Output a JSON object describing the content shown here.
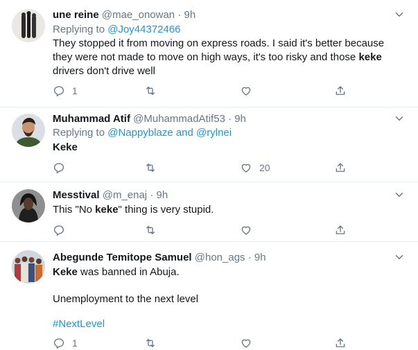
{
  "tweets": [
    {
      "name": "une reine",
      "handle": "@mae_onowan",
      "time": "9h",
      "replying_prefix": "Replying to",
      "replying_to": "@Joy44372466",
      "text_parts": [
        "They stopped it from moving on express roads. I said it's better because they were not made to move on high ways, it's too risky and those ",
        "keke",
        " drivers don't drive well"
      ],
      "reply_count": "1",
      "like_count": ""
    },
    {
      "name": "Muhammad Atif",
      "handle": "@MuhammadAtif53",
      "time": "9h",
      "replying_prefix": "Replying to",
      "replying_to": "@Nappyblaze and @rylnei",
      "text_bold": "Keke",
      "reply_count": "",
      "like_count": "20"
    },
    {
      "name": "Messtival",
      "handle": "@m_enaj",
      "time": "9h",
      "text_parts": [
        "This \"No ",
        "keke",
        "\" thing is very stupid."
      ],
      "reply_count": "",
      "like_count": ""
    },
    {
      "name": "Abegunde Temitope Samuel",
      "handle": "@hon_ags",
      "time": "9h",
      "line1_bold": "Keke",
      "line1_rest": " was banned in Abuja.",
      "line2": "Unemployment to the next level",
      "hashtag": "#NextLevel",
      "reply_count": "1",
      "like_count": ""
    }
  ],
  "icons": [
    "chevron-down-icon",
    "reply-icon",
    "retweet-icon",
    "like-icon",
    "share-icon"
  ],
  "colors": {
    "link": "#1b95e0",
    "muted": "#657786",
    "divider": "#e6ecf0"
  }
}
